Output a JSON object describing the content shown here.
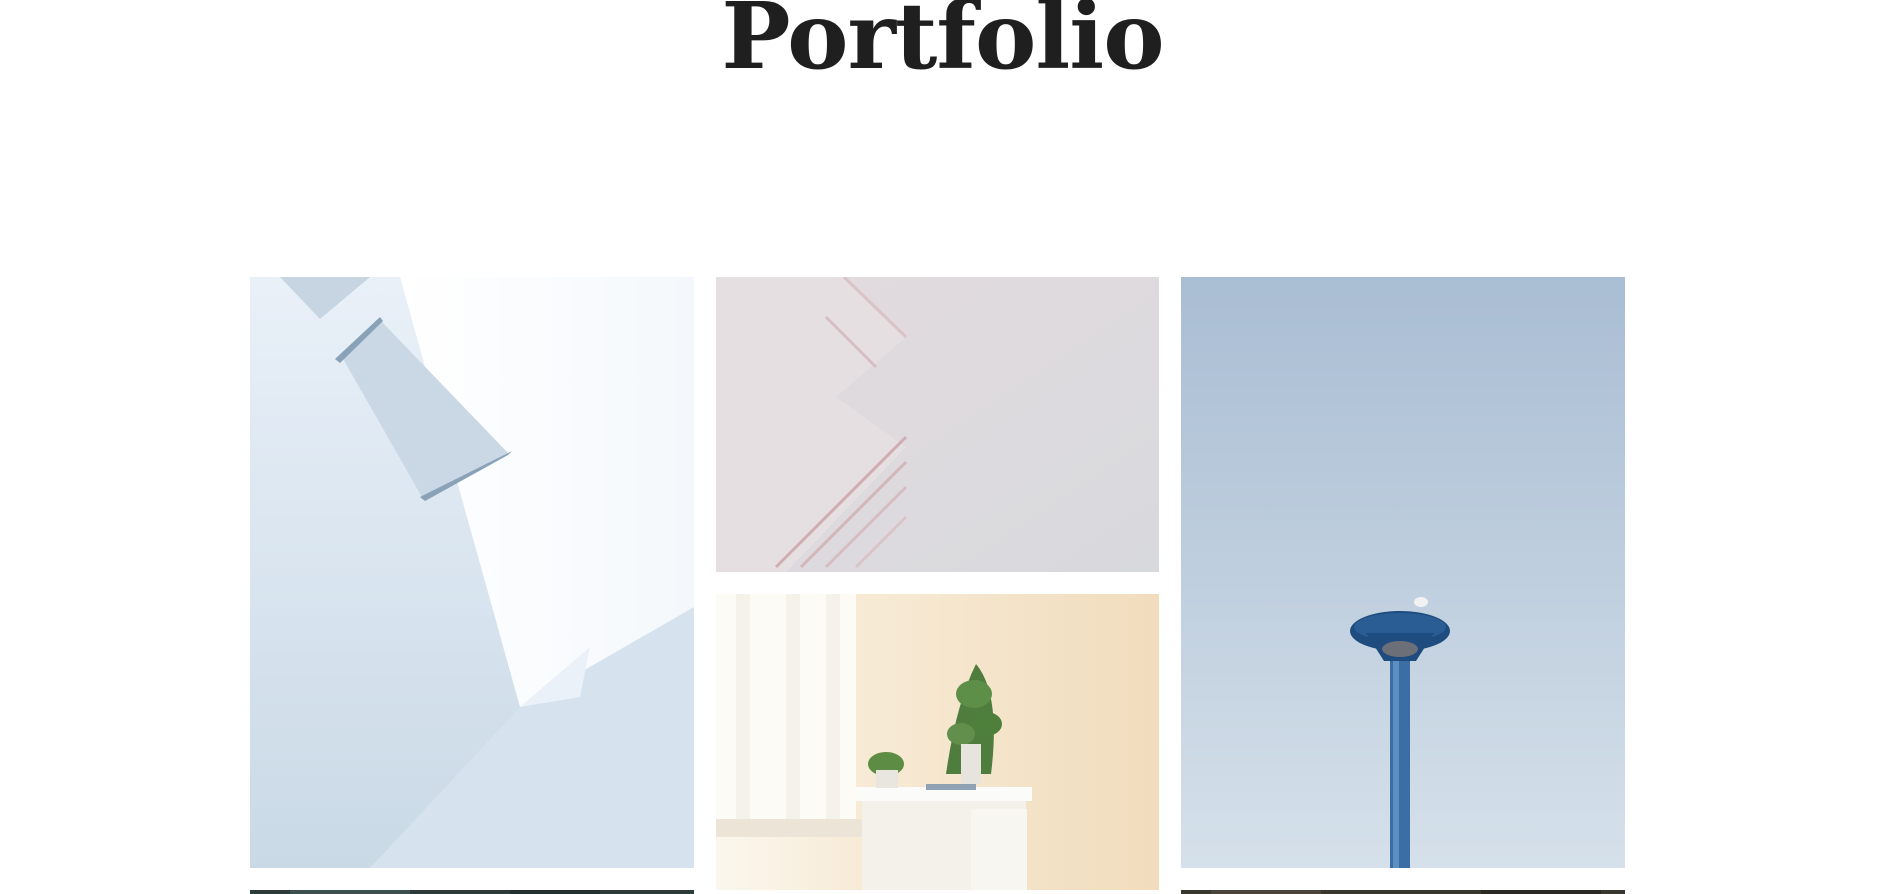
{
  "page": {
    "title": "Portfolio"
  },
  "gallery": {
    "items": [
      {
        "subject": "white-architecture-photo",
        "palette": "#dfe8f2"
      },
      {
        "subject": "folded-paper-abstract-photo",
        "palette": "#dcdcdf"
      },
      {
        "subject": "blue-street-lamp-photo",
        "palette": "#b5c6da"
      },
      {
        "subject": "dark-teal-photo-partial",
        "palette": "#2c3b3a"
      },
      {
        "subject": "desk-interior-photo",
        "palette": "#f3e3c9"
      },
      {
        "subject": "dark-photo-partial",
        "palette": "#3a3630"
      }
    ]
  },
  "colors": {
    "background": "#ffffff",
    "title": "#1f1f1f"
  }
}
